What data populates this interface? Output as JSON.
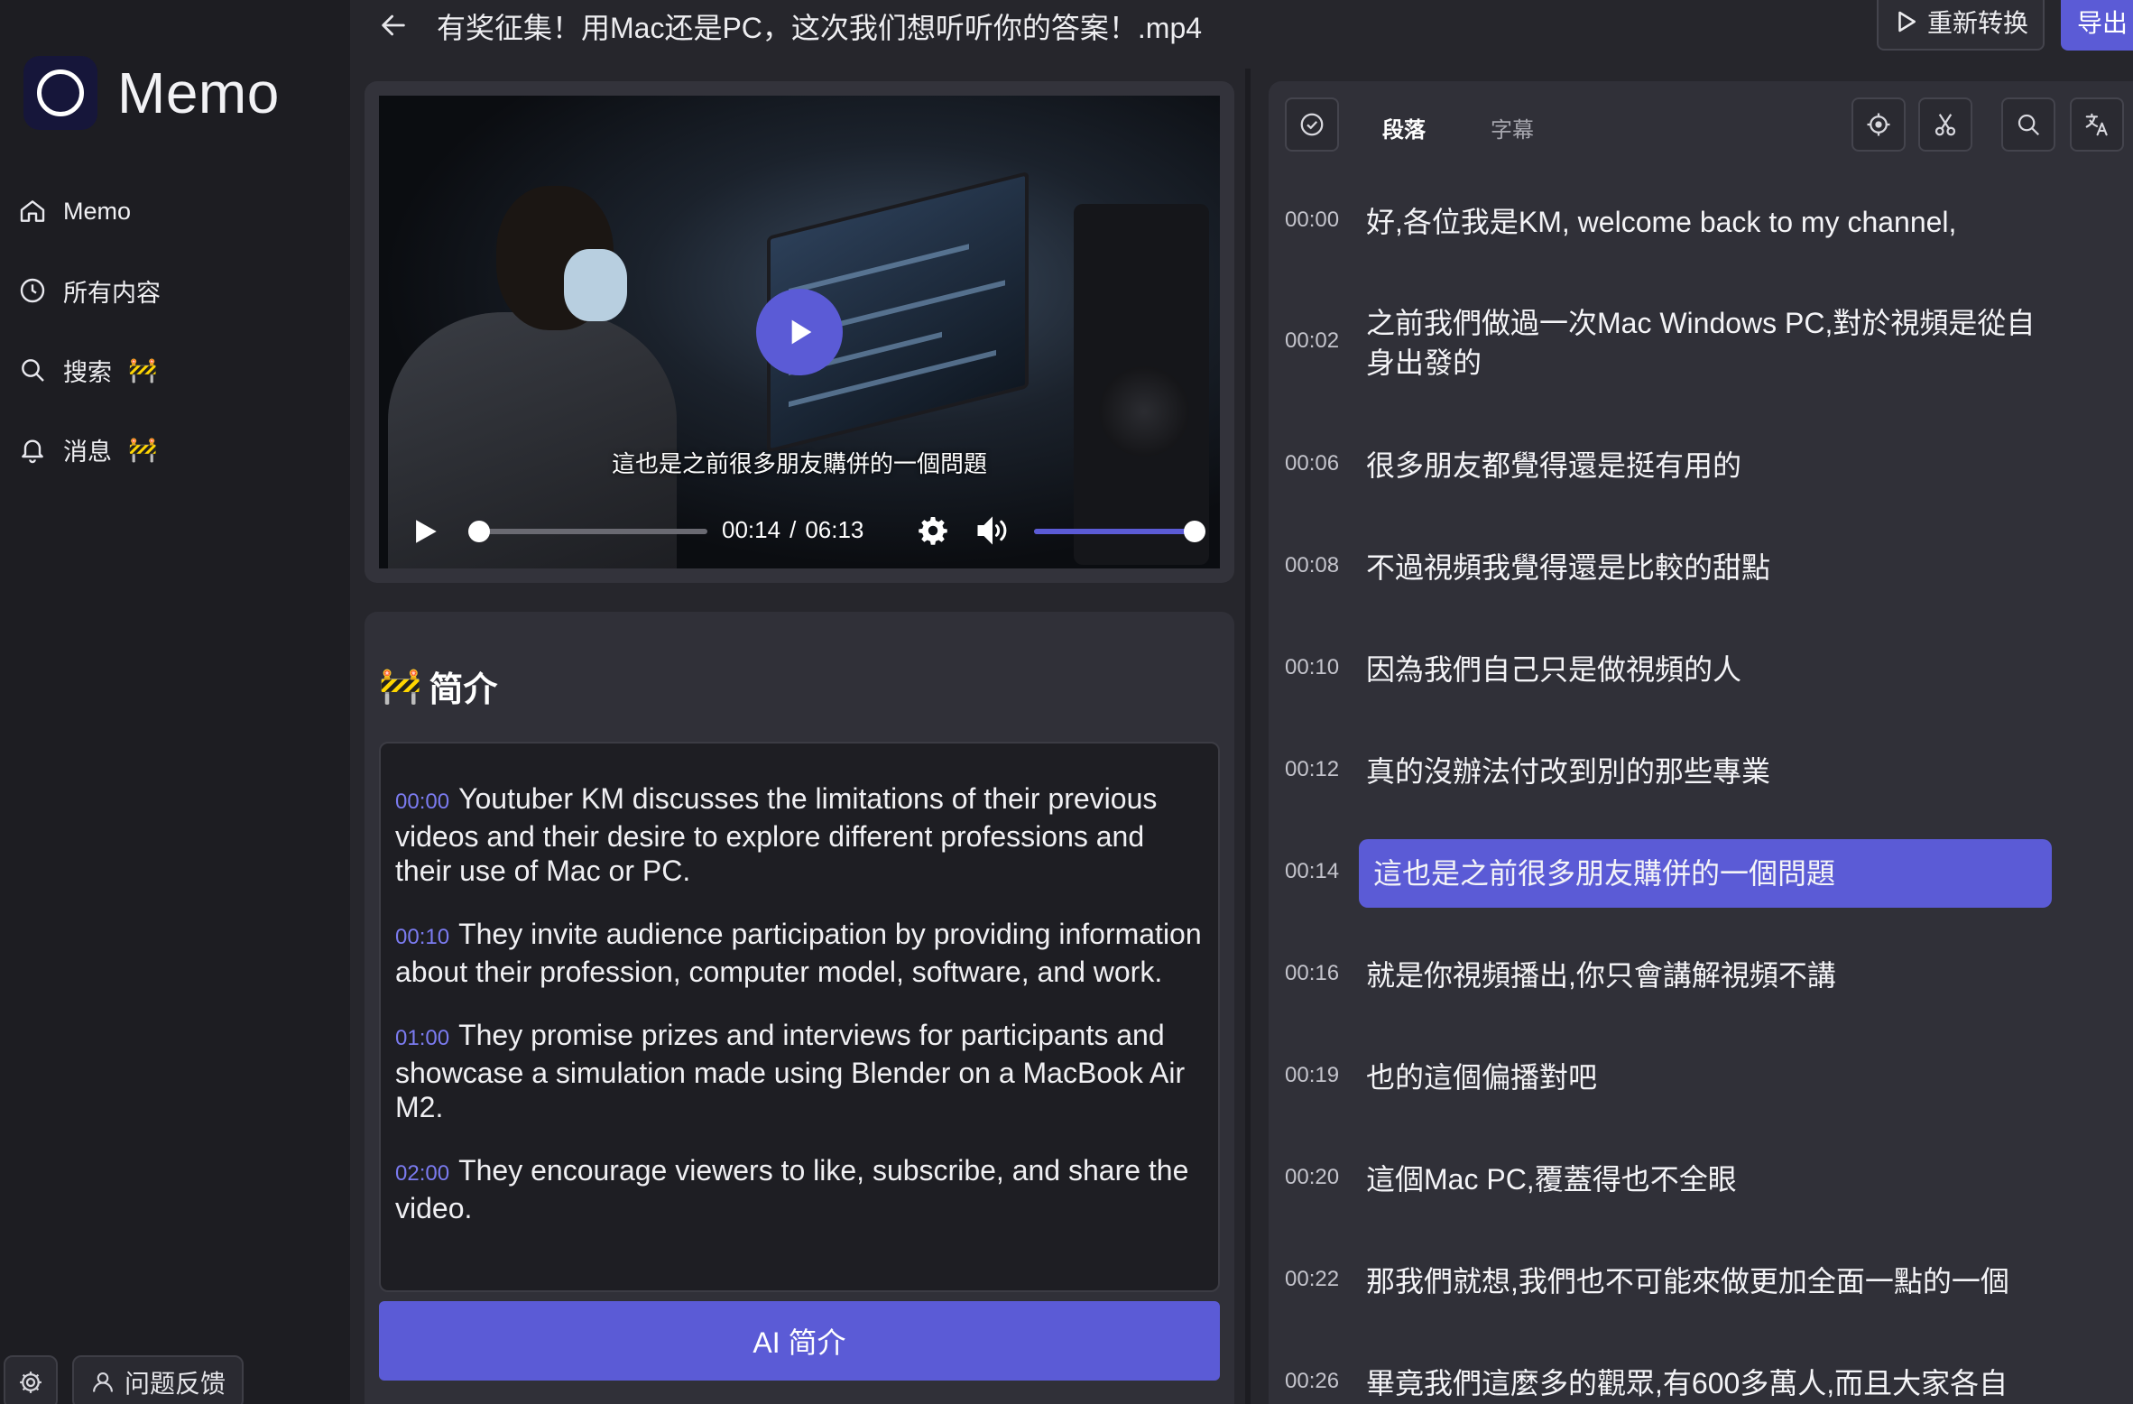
{
  "window": {
    "title": "有奖征集！用Mac还是PC，这次我们想听听你的答案！.mp4"
  },
  "colors": {
    "accent": "#5b5bd6",
    "sidebar": "#1d1d22",
    "panel": "#303038",
    "background": "#26262c"
  },
  "sidebar": {
    "brand": "Memo",
    "items": [
      {
        "label": "Memo",
        "icon": "home-icon",
        "wip": ""
      },
      {
        "label": "所有内容",
        "icon": "clock-icon",
        "wip": ""
      },
      {
        "label": "搜索",
        "icon": "search-icon",
        "wip": "🚧"
      },
      {
        "label": "消息",
        "icon": "bell-icon",
        "wip": "🚧"
      }
    ],
    "feedback_label": "问题反馈"
  },
  "header": {
    "reconvert_label": "重新转换",
    "export_label": "导出"
  },
  "player": {
    "subtitle": "這也是之前很多朋友購併的一個問題",
    "current_time": "00:14",
    "separator": "/",
    "duration": "06:13",
    "progress": 0.04,
    "volume": 1.0
  },
  "summary": {
    "wip": "🚧",
    "heading": "简介",
    "items": [
      {
        "ts": "00:00",
        "text": "Youtuber KM discusses the limitations of their previous videos and their desire to explore different professions and their use of Mac or PC."
      },
      {
        "ts": "00:10",
        "text": "They invite audience participation by providing information about their profession, computer model, software, and work."
      },
      {
        "ts": "01:00",
        "text": "They promise prizes and interviews for participants and showcase a simulation made using Blender on a MacBook Air M2."
      },
      {
        "ts": "02:00",
        "text": "They encourage viewers to like, subscribe, and share the video."
      }
    ],
    "ai_button": "AI 简介"
  },
  "transcript": {
    "tabs": [
      {
        "label": "段落",
        "active": true
      },
      {
        "label": "字幕",
        "active": false
      }
    ],
    "rows": [
      {
        "ts": "00:00",
        "text": "好,各位我是KM, welcome back to my channel,",
        "active": false
      },
      {
        "ts": "00:02",
        "text": "之前我們做過一次Mac Windows PC,對於視頻是從自身出發的",
        "active": false
      },
      {
        "ts": "00:06",
        "text": "很多朋友都覺得還是挺有用的",
        "active": false
      },
      {
        "ts": "00:08",
        "text": "不過視頻我覺得還是比較的甜點",
        "active": false
      },
      {
        "ts": "00:10",
        "text": "因為我們自己只是做視頻的人",
        "active": false
      },
      {
        "ts": "00:12",
        "text": "真的沒辦法付改到別的那些專業",
        "active": false
      },
      {
        "ts": "00:14",
        "text": "這也是之前很多朋友購併的一個問題",
        "active": true
      },
      {
        "ts": "00:16",
        "text": "就是你視頻播出,你只會講解視頻不講",
        "active": false
      },
      {
        "ts": "00:19",
        "text": "也的這個偏播對吧",
        "active": false
      },
      {
        "ts": "00:20",
        "text": "這個Mac PC,覆蓋得也不全眼",
        "active": false
      },
      {
        "ts": "00:22",
        "text": "那我們就想,我們也不可能來做更加全面一點的一個",
        "active": false
      },
      {
        "ts": "00:26",
        "text": "畢竟我們這麼多的觀眾,有600多萬人,而且大家各自",
        "active": false
      }
    ]
  }
}
